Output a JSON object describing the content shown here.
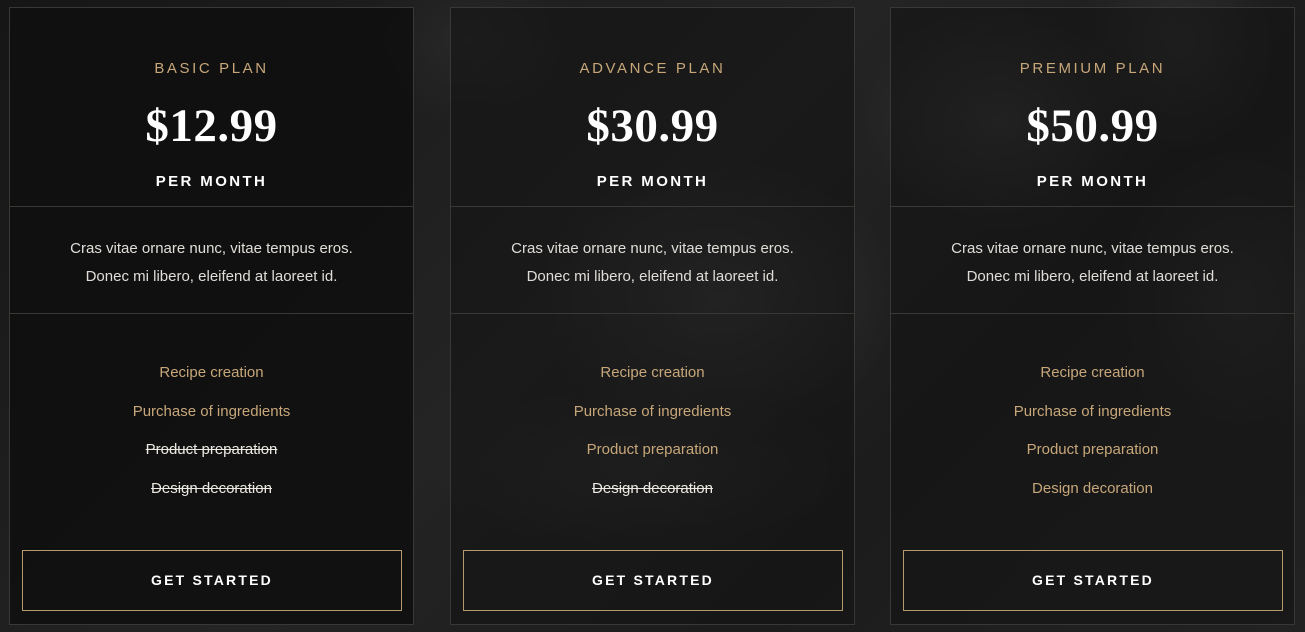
{
  "plans": [
    {
      "name": "BASIC PLAN",
      "price": "$12.99",
      "period": "PER MONTH",
      "description_lines": [
        "Cras vitae ornare nunc, vitae tempus eros.",
        "Donec mi libero, eleifend at laoreet id."
      ],
      "features": [
        {
          "label": "Recipe creation",
          "included": true
        },
        {
          "label": "Purchase of ingredients",
          "included": true
        },
        {
          "label": "Product preparation",
          "included": false
        },
        {
          "label": "Design decoration",
          "included": false
        }
      ],
      "cta": "GET STARTED"
    },
    {
      "name": "ADVANCE PLAN",
      "price": "$30.99",
      "period": "PER MONTH",
      "description_lines": [
        "Cras vitae ornare nunc, vitae tempus eros.",
        "Donec mi libero, eleifend at laoreet id."
      ],
      "features": [
        {
          "label": "Recipe creation",
          "included": true
        },
        {
          "label": "Purchase of ingredients",
          "included": true
        },
        {
          "label": "Product preparation",
          "included": true
        },
        {
          "label": "Design decoration",
          "included": false
        }
      ],
      "cta": "GET STARTED"
    },
    {
      "name": "PREMIUM PLAN",
      "price": "$50.99",
      "period": "PER MONTH",
      "description_lines": [
        "Cras vitae ornare nunc, vitae tempus eros.",
        "Donec mi libero, eleifend at laoreet id."
      ],
      "features": [
        {
          "label": "Recipe creation",
          "included": true
        },
        {
          "label": "Purchase of ingredients",
          "included": true
        },
        {
          "label": "Product preparation",
          "included": true
        },
        {
          "label": "Design decoration",
          "included": true
        }
      ],
      "cta": "GET STARTED"
    }
  ],
  "colors": {
    "accent_gold": "#c7a77a",
    "button_border": "#b59a6f",
    "text_white": "#ffffff",
    "card_border": "#3a3835"
  }
}
